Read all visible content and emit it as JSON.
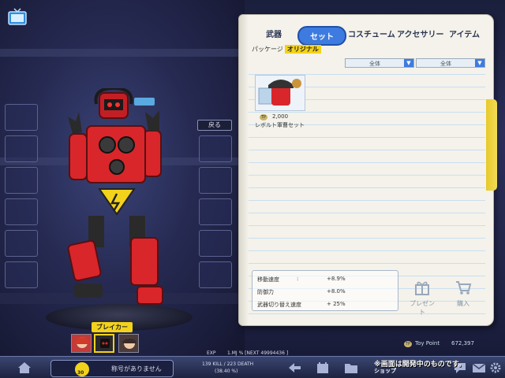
{
  "left_panel": {
    "back_button": "戻る",
    "character_label": "ブレイカー"
  },
  "shop": {
    "tabs": [
      {
        "label": "武器",
        "active": false
      },
      {
        "label": "セット",
        "active": true
      },
      {
        "label": "コスチューム",
        "active": false
      },
      {
        "label": "アクセサリー",
        "active": false
      },
      {
        "label": "アイテム",
        "active": false
      }
    ],
    "subfilter": {
      "label": "パッケージ",
      "active": "オリジナル"
    },
    "filter1": "全体",
    "filter2": "全体",
    "item": {
      "price": "2,000",
      "currency_badge": "TP",
      "name": "レボルト軍曹セット"
    },
    "stats": [
      {
        "name": "移動速度",
        "sep": ":",
        "value": "+8.9%"
      },
      {
        "name": "防御力",
        "sep": "",
        "value": "+8.0%"
      },
      {
        "name": "武器切り替え速度",
        "sep": "",
        "value": "+ 25%"
      }
    ],
    "present_label": "プレゼント",
    "buy_label": "購入"
  },
  "toy_point": {
    "badge": "TP",
    "label": "Toy Point",
    "value": "672,397"
  },
  "bottom": {
    "exp_label": "EXP",
    "exp_text": "1.MJ % [NEXT 49994436 ]",
    "title_text": "称号がありません",
    "level": "30",
    "kill_death": "139 KILL / 223 DEATH",
    "ratio": "(38.40 %)",
    "shop_label": "ショップ"
  },
  "dev_note": "※画面は開発中のものです。",
  "colors": {
    "accent": "#3d7be0",
    "highlight": "#f3d21b",
    "robot_red": "#d8262b"
  }
}
